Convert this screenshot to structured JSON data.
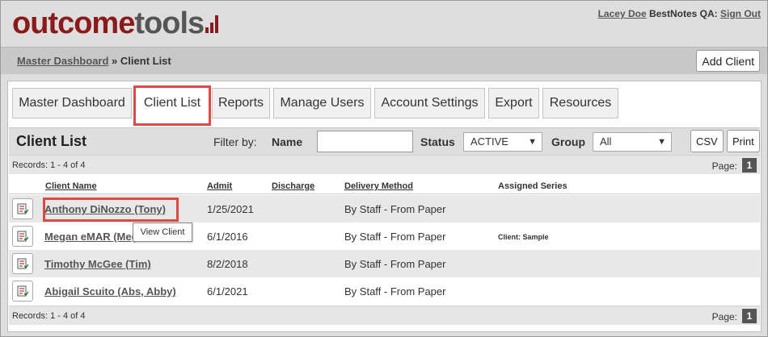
{
  "logo": {
    "part1": "outcome",
    "part2": "tools"
  },
  "user": {
    "name": "Lacey Doe",
    "org": "BestNotes QA:",
    "signout": "Sign Out"
  },
  "breadcrumb": {
    "parent": "Master Dashboard",
    "separator": "»",
    "current": "Client List"
  },
  "add_client_label": "Add Client",
  "tabs": [
    "Master Dashboard",
    "Client List",
    "Reports",
    "Manage Users",
    "Account Settings",
    "Export",
    "Resources"
  ],
  "active_tab": "Client List",
  "list": {
    "title": "Client List",
    "filter_by": "Filter by:",
    "name_label": "Name",
    "name_value": "",
    "status_label": "Status",
    "status_value": "ACTIVE",
    "group_label": "Group",
    "group_value": "All",
    "csv_label": "CSV",
    "print_label": "Print",
    "records_text": "Records: 1 - 4 of 4",
    "page_label": "Page:",
    "page_number": "1"
  },
  "columns": {
    "client_name": "Client Name",
    "admit": "Admit",
    "discharge": "Discharge",
    "delivery": "Delivery Method",
    "series": "Assigned Series"
  },
  "rows": [
    {
      "name": "Anthony DiNozzo (Tony)",
      "admit": "1/25/2021",
      "discharge": "",
      "delivery": "By Staff - From Paper",
      "series": ""
    },
    {
      "name": "Megan eMAR (Meg",
      "admit": "6/1/2016",
      "discharge": "",
      "delivery": "By Staff - From Paper",
      "series": "Client: Sample"
    },
    {
      "name": "Timothy McGee (Tim)",
      "admit": "8/2/2018",
      "discharge": "",
      "delivery": "By Staff - From Paper",
      "series": ""
    },
    {
      "name": "Abigail Scuito (Abs, Abby)",
      "admit": "6/1/2021",
      "discharge": "",
      "delivery": "By Staff - From Paper",
      "series": ""
    }
  ],
  "tooltip": "View Client",
  "colors": {
    "brand_red": "#8b1a1a",
    "highlight": "#e04848",
    "logo_gray": "#555555"
  }
}
